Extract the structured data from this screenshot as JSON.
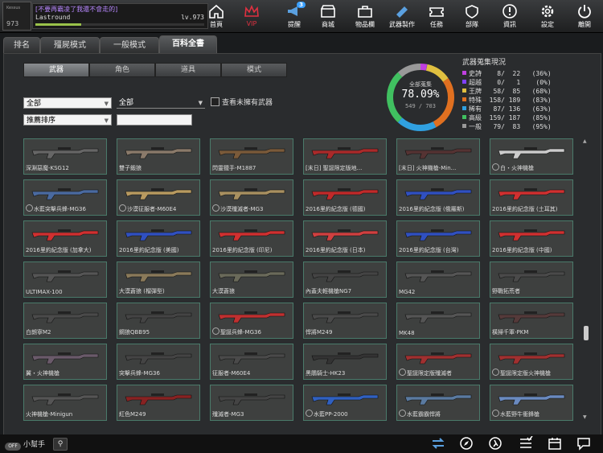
{
  "player": {
    "rank": "973",
    "rank_title": "Kessus",
    "motto": "[不要再霸凌了我還不會走的]",
    "username": "Lastround",
    "level": "lv.973",
    "exp_percent": 27
  },
  "nav": [
    {
      "label": "首頁",
      "icon": "home-icon"
    },
    {
      "label": "VIP",
      "icon": "crown-icon"
    },
    {
      "label": "提醒",
      "icon": "megaphone-icon",
      "badge": "3"
    },
    {
      "label": "商城",
      "icon": "shop-icon"
    },
    {
      "label": "物品欄",
      "icon": "bag-icon"
    },
    {
      "label": "武器製作",
      "icon": "craft-icon"
    },
    {
      "label": "任務",
      "icon": "ticket-icon"
    },
    {
      "label": "部隊",
      "icon": "clan-icon"
    },
    {
      "label": "資訊",
      "icon": "info-icon"
    },
    {
      "label": "設定",
      "icon": "gear-icon"
    },
    {
      "label": "離開",
      "icon": "power-icon"
    }
  ],
  "tabs": [
    "排名",
    "殭屍模式",
    "一般模式",
    "百科全書"
  ],
  "subtabs": [
    "武器",
    "角色",
    "道具",
    "模式"
  ],
  "filters": {
    "category": "全部",
    "subcategory": "全部",
    "sort": "推薦排序",
    "show_unowned_label": "查看未擁有武器"
  },
  "collection": {
    "label": "全部蒐集",
    "percent": "78.09%",
    "count": "549 / 703",
    "title": "武器蒐集現況",
    "rows": [
      {
        "name": "史詩",
        "owned": "8",
        "total": "22",
        "pct": "(36%)",
        "color": "#c040e0"
      },
      {
        "name": "超越",
        "owned": "0",
        "total": "1",
        "pct": "(0%)",
        "color": "#8040ff"
      },
      {
        "name": "王牌",
        "owned": "58",
        "total": "85",
        "pct": "(68%)",
        "color": "#e0c040"
      },
      {
        "name": "特殊",
        "owned": "158",
        "total": "189",
        "pct": "(83%)",
        "color": "#e07020"
      },
      {
        "name": "稀有",
        "owned": "87",
        "total": "136",
        "pct": "(63%)",
        "color": "#30a0e0"
      },
      {
        "name": "高級",
        "owned": "159",
        "total": "187",
        "pct": "(85%)",
        "color": "#40c060"
      },
      {
        "name": "一般",
        "owned": "79",
        "total": "83",
        "pct": "(95%)",
        "color": "#999999"
      }
    ]
  },
  "weapons": [
    {
      "name": "深淵惡魔-KSG12",
      "locked": false,
      "color": "#666666"
    },
    {
      "name": "雙子鍛狼",
      "locked": false,
      "color": "#8a7a6a"
    },
    {
      "name": "閃靈獵手-M1887",
      "locked": false,
      "color": "#7a5a3a"
    },
    {
      "name": "[末日] 聖誕限定版地...",
      "locked": false,
      "color": "#aa2a2a"
    },
    {
      "name": "[末日] 火神機槍-Min...",
      "locked": false,
      "color": "#553333"
    },
    {
      "name": "白・火神機槍",
      "locked": true,
      "color": "#cccccc"
    },
    {
      "name": "水藍突擊兵蜂-MG36",
      "locked": true,
      "color": "#4a6aa0"
    },
    {
      "name": "沙漠征服者-M60E4",
      "locked": true,
      "color": "#b89a60"
    },
    {
      "name": "沙漠殲滅者-MG3",
      "locked": true,
      "color": "#a89060"
    },
    {
      "name": "2016里約紀念版 (德國)",
      "locked": false,
      "color": "#c02a2a"
    },
    {
      "name": "2016里約紀念版 (俄羅斯)",
      "locked": false,
      "color": "#3050c0"
    },
    {
      "name": "2016里約紀念版 (土耳其)",
      "locked": false,
      "color": "#d03030"
    },
    {
      "name": "2016里約紀念版 (加拿大)",
      "locked": false,
      "color": "#d03030"
    },
    {
      "name": "2016里約紀念版 (美國)",
      "locked": false,
      "color": "#3050c0"
    },
    {
      "name": "2016里約紀念版 (印尼)",
      "locked": false,
      "color": "#d03030"
    },
    {
      "name": "2016里約紀念版 (日本)",
      "locked": false,
      "color": "#d04040"
    },
    {
      "name": "2016里約紀念版 (台灣)",
      "locked": false,
      "color": "#3050c0"
    },
    {
      "name": "2016里約紀念版 (中國)",
      "locked": false,
      "color": "#d03030"
    },
    {
      "name": "ULTIMAX-100",
      "locked": false,
      "color": "#555555"
    },
    {
      "name": "大漠蒼狼 (榴彈型)",
      "locked": false,
      "color": "#8a7a5a"
    },
    {
      "name": "大漠蒼狼",
      "locked": false,
      "color": "#6a6a5a"
    },
    {
      "name": "內蓋夫輕機槍NG7",
      "locked": false,
      "color": "#444444"
    },
    {
      "name": "MG42",
      "locked": false,
      "color": "#555555"
    },
    {
      "name": "野戰拓荒者",
      "locked": false,
      "color": "#4a4a4a"
    },
    {
      "name": "白朗寧M2",
      "locked": false,
      "color": "#4a4a4a"
    },
    {
      "name": "鋼狼QBB95",
      "locked": false,
      "color": "#444444"
    },
    {
      "name": "聖誕兵蜂-MG36",
      "locked": true,
      "color": "#c03030"
    },
    {
      "name": "悍將M249",
      "locked": false,
      "color": "#4a4a4a"
    },
    {
      "name": "MK48",
      "locked": false,
      "color": "#555555"
    },
    {
      "name": "橫掃千軍-PKM",
      "locked": false,
      "color": "#553a3a"
    },
    {
      "name": "翼・火神機槍",
      "locked": false,
      "color": "#6a5a6a"
    },
    {
      "name": "突擊兵蜂-MG36",
      "locked": false,
      "color": "#444444"
    },
    {
      "name": "征服者-M60E4",
      "locked": false,
      "color": "#4a4a4a"
    },
    {
      "name": "黑鵰騎士-HK23",
      "locked": false,
      "color": "#333333"
    },
    {
      "name": "聖誕限定版殲滅者",
      "locked": true,
      "color": "#a03030"
    },
    {
      "name": "聖誕限定版火神機槍",
      "locked": true,
      "color": "#a03030"
    },
    {
      "name": "火神機槍-Minigun",
      "locked": false,
      "color": "#555555"
    },
    {
      "name": "紅色M249",
      "locked": false,
      "color": "#882222"
    },
    {
      "name": "殲滅者-MG3",
      "locked": false,
      "color": "#444444"
    },
    {
      "name": "水藍PP-2000",
      "locked": true,
      "color": "#3060c0"
    },
    {
      "name": "水藍霸霸悍將",
      "locked": true,
      "color": "#5a7aa0"
    },
    {
      "name": "水藍野牛衝鋒槍",
      "locked": true,
      "color": "#6a8ac0"
    }
  ],
  "bottom": {
    "help_label": "小幫手",
    "toggle_label": "OFF",
    "icons": [
      "swap-icon",
      "compass-icon",
      "runner-icon",
      "checklist-icon",
      "calendar-icon",
      "chat-icon"
    ]
  }
}
